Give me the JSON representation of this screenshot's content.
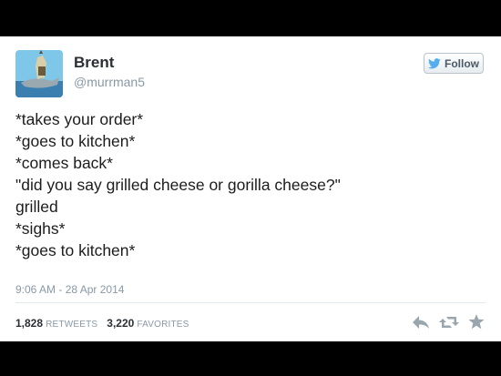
{
  "user": {
    "name": "Brent",
    "handle": "@murrman5"
  },
  "follow_button": {
    "label": "Follow",
    "icon": "twitter-bird-icon",
    "color": "#55acee"
  },
  "tweet": {
    "lines": [
      "*takes your order*",
      "*goes to kitchen*",
      "*comes back*",
      "\"did you say grilled cheese or gorilla cheese?\"",
      "grilled",
      "*sighs*",
      "*goes to kitchen*"
    ],
    "timestamp": "9:06 AM - 28 Apr 2014"
  },
  "stats": {
    "retweets_count": "1,828",
    "retweets_label": "RETWEETS",
    "favorites_count": "3,220",
    "favorites_label": "FAVORITES"
  },
  "actions": [
    "reply-icon",
    "retweet-icon",
    "favorite-icon"
  ]
}
